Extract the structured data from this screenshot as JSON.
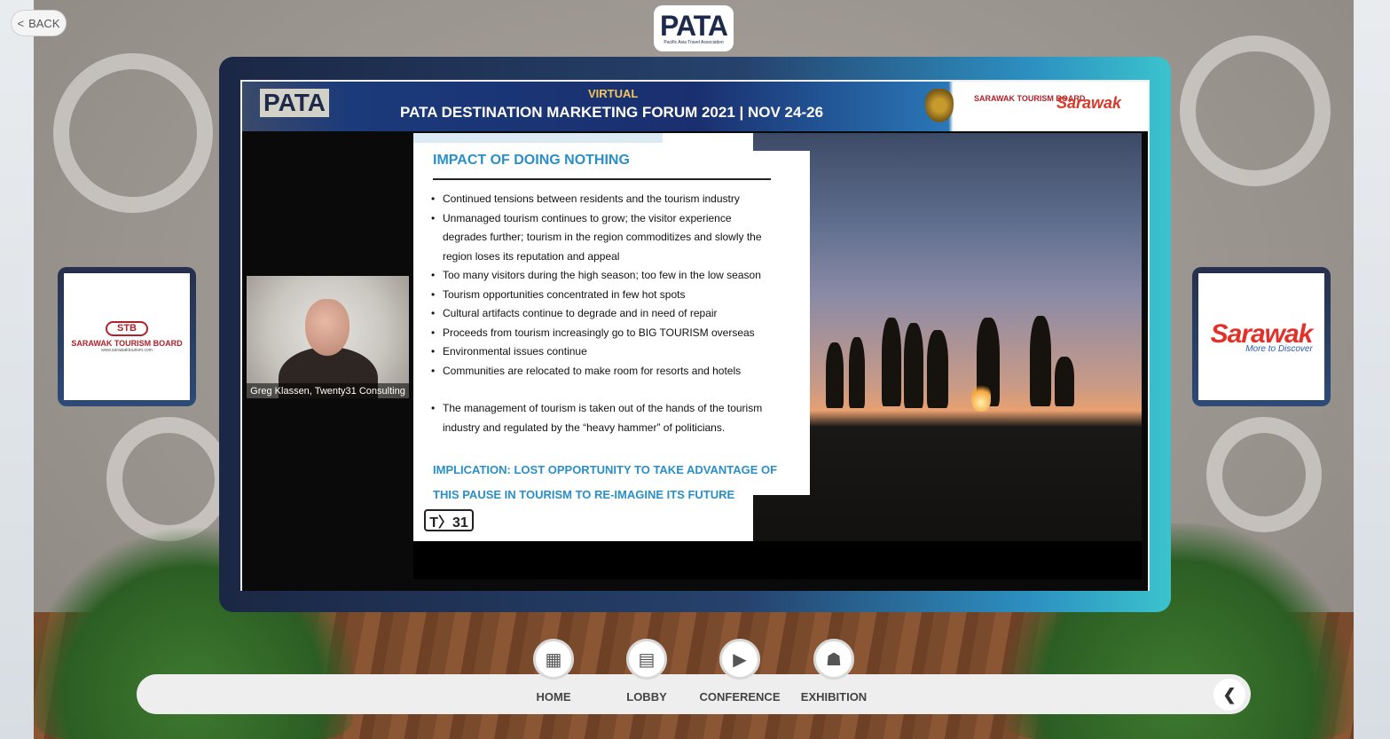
{
  "header": {
    "back_label": "BACK",
    "logo": {
      "word": "PATA",
      "subtitle": "Pacific Asia Travel Association"
    }
  },
  "slide_banner": {
    "virtual": "VIRTUAL",
    "title": "PATA DESTINATION MARKETING FORUM 2021 | NOV 24-26",
    "pata_word": "PATA",
    "stb_label": "SARAWAK TOURISM BOARD",
    "sarawak_word": "Sarawak"
  },
  "video": {
    "speaker_name": "Greg Klassen, Twenty31 Consulting"
  },
  "slide": {
    "heading": "IMPACT OF DOING NOTHING",
    "bullets": [
      "Continued tensions between residents and the tourism industry",
      "Unmanaged tourism continues to grow; the visitor experience degrades further; tourism in the region commoditizes and slowly the region loses its reputation and appeal",
      "Too many visitors during the high season; too few in the low season",
      "Tourism opportunities concentrated in few hot spots",
      "Cultural artifacts continue to degrade and in need of repair",
      "Proceeds from tourism increasingly go to BIG TOURISM overseas",
      "Environmental issues continue",
      "Communities are relocated to make room for resorts and hotels",
      "The management of tourism is taken out of the hands of the tourism industry and regulated by the “heavy hammer” of politicians."
    ],
    "implication": "IMPLICATION: LOST OPPORTUNITY TO TAKE ADVANTAGE OF THIS PAUSE IN TOURISM TO RE-IMAGINE ITS FUTURE",
    "brand_mark": "T〉31"
  },
  "left_board": {
    "badge": "STB",
    "name": "SARAWAK TOURISM BOARD",
    "url": "www.sarawaktourism.com"
  },
  "right_board": {
    "word": "Sarawak",
    "tagline": "More to Discover"
  },
  "nav": {
    "items": [
      {
        "label": "HOME",
        "icon": "building-icon"
      },
      {
        "label": "LOBBY",
        "icon": "sofa-icon"
      },
      {
        "label": "CONFERENCE",
        "icon": "video-stack-icon"
      },
      {
        "label": "EXHIBITION",
        "icon": "booth-icon"
      }
    ],
    "collapse_icon": "chevron-left-icon"
  },
  "colors": {
    "accent_blue": "#2a8fc8",
    "screen_frame": "#26426d",
    "stb_red": "#b0222a",
    "sarawak_red": "#e0322a"
  }
}
